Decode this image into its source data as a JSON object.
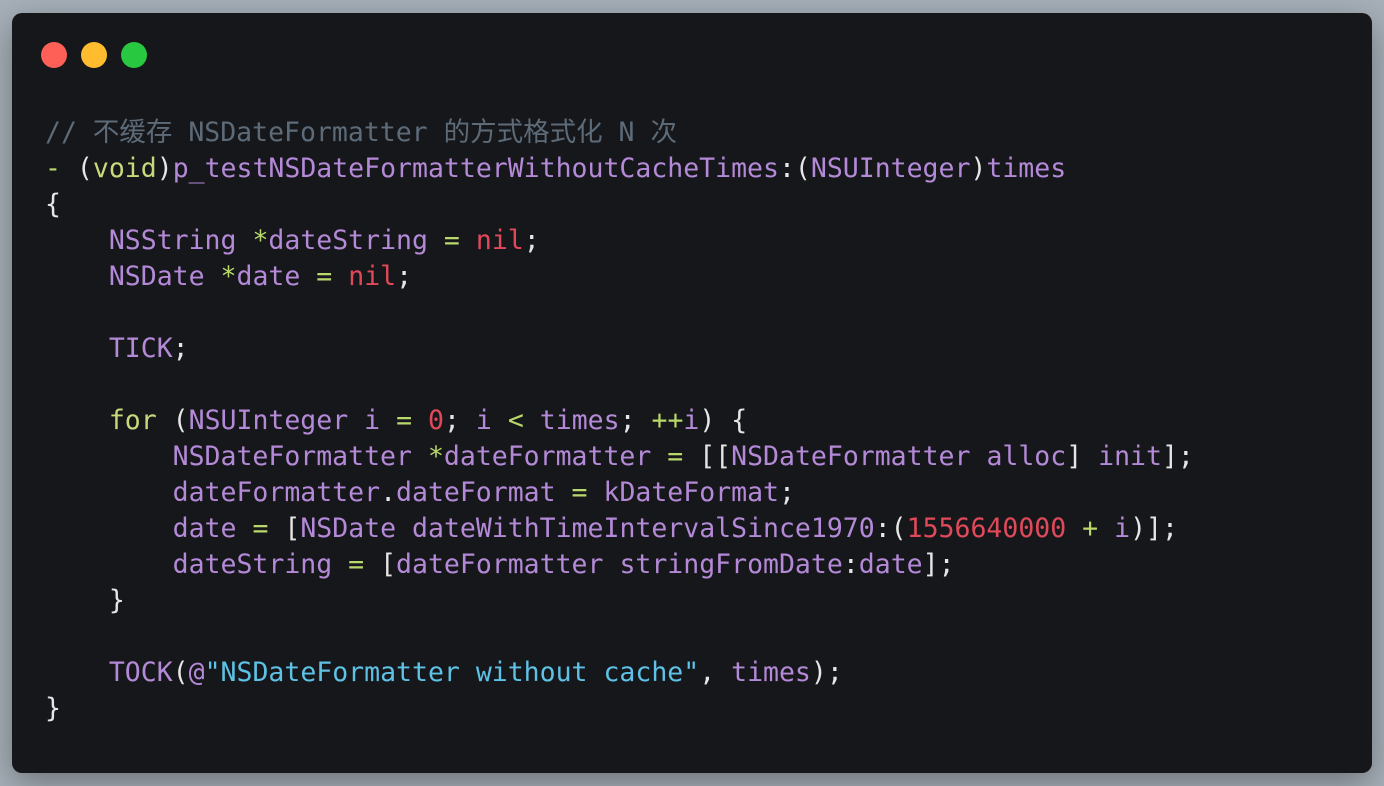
{
  "window": {
    "traffic_lights": {
      "close_color": "#fe5f57",
      "minimize_color": "#febc2e",
      "zoom_color": "#28c840"
    },
    "background_color": "#16171a"
  },
  "code": {
    "lines": [
      [
        {
          "t": "// 不缓存 NSDateFormatter 的方式格式化 N 次",
          "c": "comment"
        }
      ],
      [
        {
          "t": "- ",
          "c": "op"
        },
        {
          "t": "(",
          "c": "plain"
        },
        {
          "t": "void",
          "c": "keyword"
        },
        {
          "t": ")",
          "c": "plain"
        },
        {
          "t": "p_testNSDateFormatterWithoutCacheTimes",
          "c": "var"
        },
        {
          "t": ":(",
          "c": "plain"
        },
        {
          "t": "NSUInteger",
          "c": "type"
        },
        {
          "t": ")",
          "c": "plain"
        },
        {
          "t": "times",
          "c": "var"
        }
      ],
      [
        {
          "t": "{",
          "c": "plain"
        }
      ],
      [
        {
          "t": "    ",
          "c": "plain"
        },
        {
          "t": "NSString",
          "c": "type"
        },
        {
          "t": " ",
          "c": "plain"
        },
        {
          "t": "*",
          "c": "op"
        },
        {
          "t": "dateString",
          "c": "var"
        },
        {
          "t": " ",
          "c": "plain"
        },
        {
          "t": "=",
          "c": "op"
        },
        {
          "t": " ",
          "c": "plain"
        },
        {
          "t": "nil",
          "c": "nil"
        },
        {
          "t": ";",
          "c": "plain"
        }
      ],
      [
        {
          "t": "    ",
          "c": "plain"
        },
        {
          "t": "NSDate",
          "c": "type"
        },
        {
          "t": " ",
          "c": "plain"
        },
        {
          "t": "*",
          "c": "op"
        },
        {
          "t": "date",
          "c": "var"
        },
        {
          "t": " ",
          "c": "plain"
        },
        {
          "t": "=",
          "c": "op"
        },
        {
          "t": " ",
          "c": "plain"
        },
        {
          "t": "nil",
          "c": "nil"
        },
        {
          "t": ";",
          "c": "plain"
        }
      ],
      [],
      [
        {
          "t": "    ",
          "c": "plain"
        },
        {
          "t": "TICK",
          "c": "macro"
        },
        {
          "t": ";",
          "c": "plain"
        }
      ],
      [],
      [
        {
          "t": "    ",
          "c": "plain"
        },
        {
          "t": "for",
          "c": "keyword"
        },
        {
          "t": " (",
          "c": "plain"
        },
        {
          "t": "NSUInteger",
          "c": "type"
        },
        {
          "t": " ",
          "c": "plain"
        },
        {
          "t": "i",
          "c": "var"
        },
        {
          "t": " ",
          "c": "plain"
        },
        {
          "t": "=",
          "c": "op"
        },
        {
          "t": " ",
          "c": "plain"
        },
        {
          "t": "0",
          "c": "num"
        },
        {
          "t": "; ",
          "c": "plain"
        },
        {
          "t": "i",
          "c": "var"
        },
        {
          "t": " ",
          "c": "plain"
        },
        {
          "t": "<",
          "c": "op"
        },
        {
          "t": " ",
          "c": "plain"
        },
        {
          "t": "times",
          "c": "var"
        },
        {
          "t": "; ",
          "c": "plain"
        },
        {
          "t": "++",
          "c": "op"
        },
        {
          "t": "i",
          "c": "var"
        },
        {
          "t": ") {",
          "c": "plain"
        }
      ],
      [
        {
          "t": "        ",
          "c": "plain"
        },
        {
          "t": "NSDateFormatter",
          "c": "type"
        },
        {
          "t": " ",
          "c": "plain"
        },
        {
          "t": "*",
          "c": "op"
        },
        {
          "t": "dateFormatter",
          "c": "var"
        },
        {
          "t": " ",
          "c": "plain"
        },
        {
          "t": "=",
          "c": "op"
        },
        {
          "t": " [[",
          "c": "plain"
        },
        {
          "t": "NSDateFormatter",
          "c": "type"
        },
        {
          "t": " ",
          "c": "plain"
        },
        {
          "t": "alloc",
          "c": "var"
        },
        {
          "t": "] ",
          "c": "plain"
        },
        {
          "t": "init",
          "c": "var"
        },
        {
          "t": "];",
          "c": "plain"
        }
      ],
      [
        {
          "t": "        ",
          "c": "plain"
        },
        {
          "t": "dateFormatter",
          "c": "var"
        },
        {
          "t": ".",
          "c": "plain"
        },
        {
          "t": "dateFormat",
          "c": "var"
        },
        {
          "t": " ",
          "c": "plain"
        },
        {
          "t": "=",
          "c": "op"
        },
        {
          "t": " ",
          "c": "plain"
        },
        {
          "t": "kDateFormat",
          "c": "var"
        },
        {
          "t": ";",
          "c": "plain"
        }
      ],
      [
        {
          "t": "        ",
          "c": "plain"
        },
        {
          "t": "date",
          "c": "var"
        },
        {
          "t": " ",
          "c": "plain"
        },
        {
          "t": "=",
          "c": "op"
        },
        {
          "t": " [",
          "c": "plain"
        },
        {
          "t": "NSDate",
          "c": "type"
        },
        {
          "t": " ",
          "c": "plain"
        },
        {
          "t": "dateWithTimeIntervalSince1970",
          "c": "var"
        },
        {
          "t": ":(",
          "c": "plain"
        },
        {
          "t": "1556640000",
          "c": "num"
        },
        {
          "t": " ",
          "c": "plain"
        },
        {
          "t": "+",
          "c": "op"
        },
        {
          "t": " ",
          "c": "plain"
        },
        {
          "t": "i",
          "c": "var"
        },
        {
          "t": ")];",
          "c": "plain"
        }
      ],
      [
        {
          "t": "        ",
          "c": "plain"
        },
        {
          "t": "dateString",
          "c": "var"
        },
        {
          "t": " ",
          "c": "plain"
        },
        {
          "t": "=",
          "c": "op"
        },
        {
          "t": " [",
          "c": "plain"
        },
        {
          "t": "dateFormatter",
          "c": "var"
        },
        {
          "t": " ",
          "c": "plain"
        },
        {
          "t": "stringFromDate",
          "c": "var"
        },
        {
          "t": ":",
          "c": "plain"
        },
        {
          "t": "date",
          "c": "var"
        },
        {
          "t": "];",
          "c": "plain"
        }
      ],
      [
        {
          "t": "    }",
          "c": "plain"
        }
      ],
      [],
      [
        {
          "t": "    ",
          "c": "plain"
        },
        {
          "t": "TOCK",
          "c": "macro"
        },
        {
          "t": "(",
          "c": "plain"
        },
        {
          "t": "@",
          "c": "type"
        },
        {
          "t": "\"NSDateFormatter without cache\"",
          "c": "string"
        },
        {
          "t": ", ",
          "c": "plain"
        },
        {
          "t": "times",
          "c": "var"
        },
        {
          "t": ");",
          "c": "plain"
        }
      ],
      [
        {
          "t": "}",
          "c": "plain"
        }
      ]
    ]
  }
}
